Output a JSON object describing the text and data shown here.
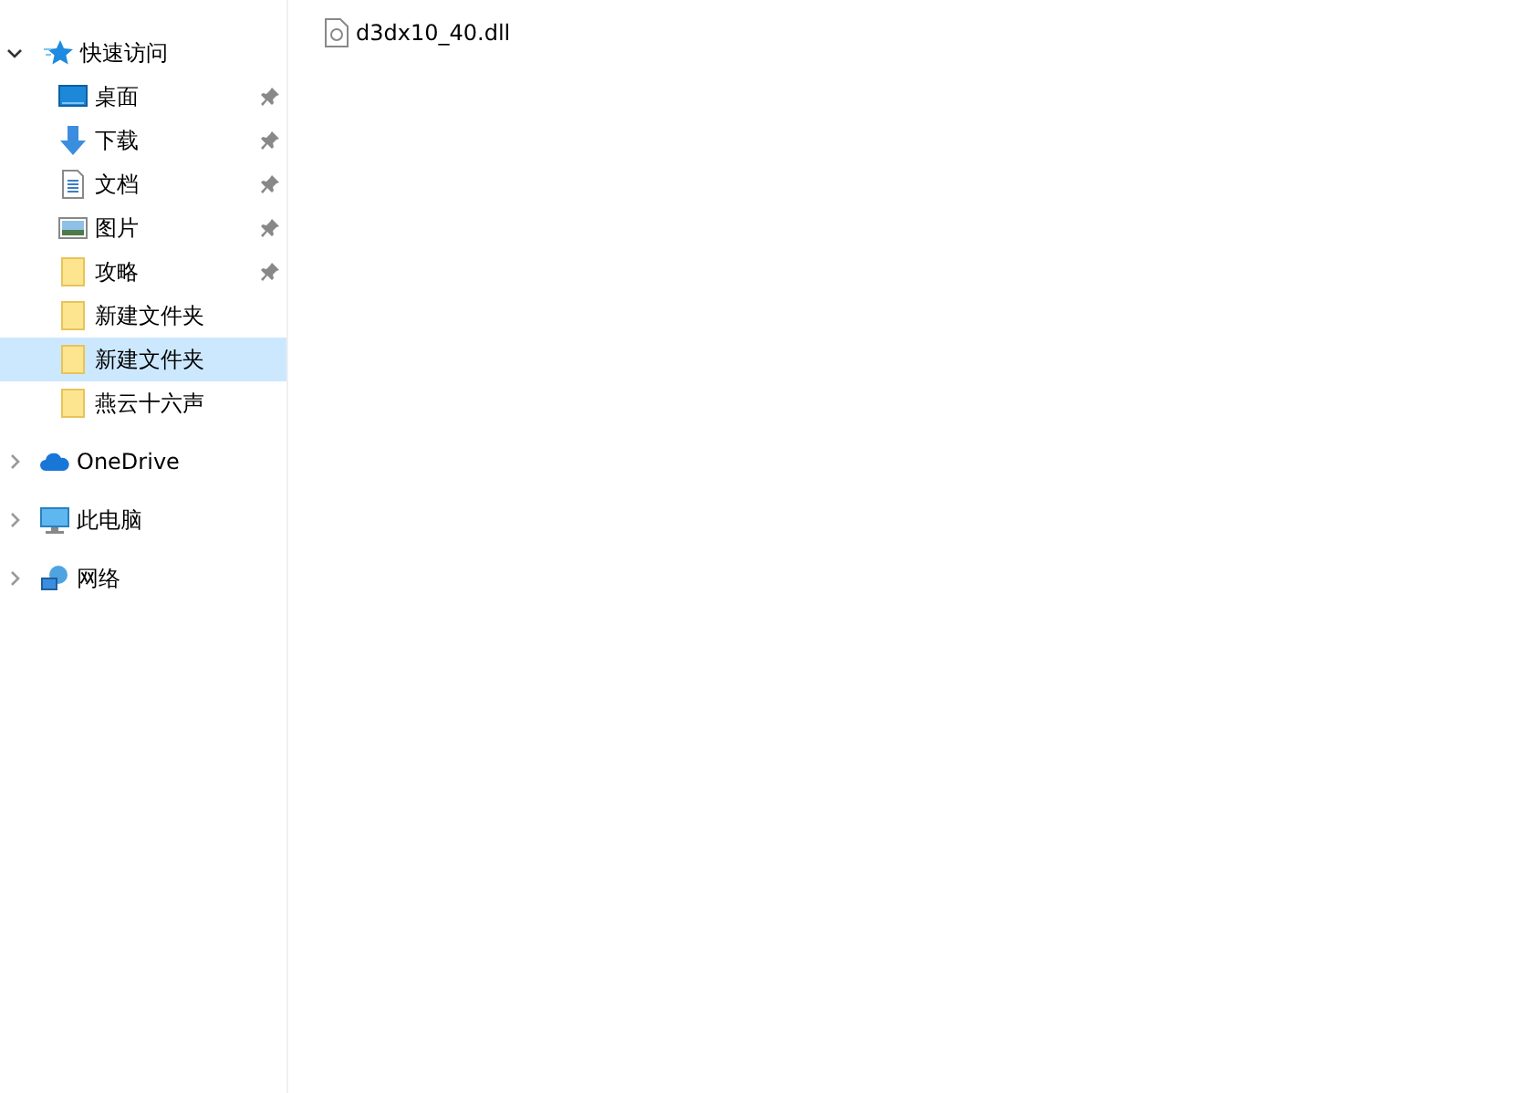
{
  "quick_access": {
    "label": "快速访问",
    "expanded": true,
    "items": [
      {
        "label": "桌面",
        "kind": "desktop",
        "pinned": true,
        "selected": false
      },
      {
        "label": "下载",
        "kind": "download",
        "pinned": true,
        "selected": false
      },
      {
        "label": "文档",
        "kind": "document",
        "pinned": true,
        "selected": false
      },
      {
        "label": "图片",
        "kind": "pictures",
        "pinned": true,
        "selected": false
      },
      {
        "label": "攻略",
        "kind": "folder",
        "pinned": true,
        "selected": false
      },
      {
        "label": "新建文件夹",
        "kind": "folder",
        "pinned": false,
        "selected": false
      },
      {
        "label": "新建文件夹",
        "kind": "folder",
        "pinned": false,
        "selected": true
      },
      {
        "label": "燕云十六声",
        "kind": "folder",
        "pinned": false,
        "selected": false
      }
    ]
  },
  "roots": [
    {
      "label": "OneDrive",
      "kind": "cloud",
      "expanded": false
    },
    {
      "label": "此电脑",
      "kind": "computer",
      "expanded": false
    },
    {
      "label": "网络",
      "kind": "network",
      "expanded": false
    }
  ],
  "files": [
    {
      "name": "d3dx10_40.dll"
    }
  ]
}
